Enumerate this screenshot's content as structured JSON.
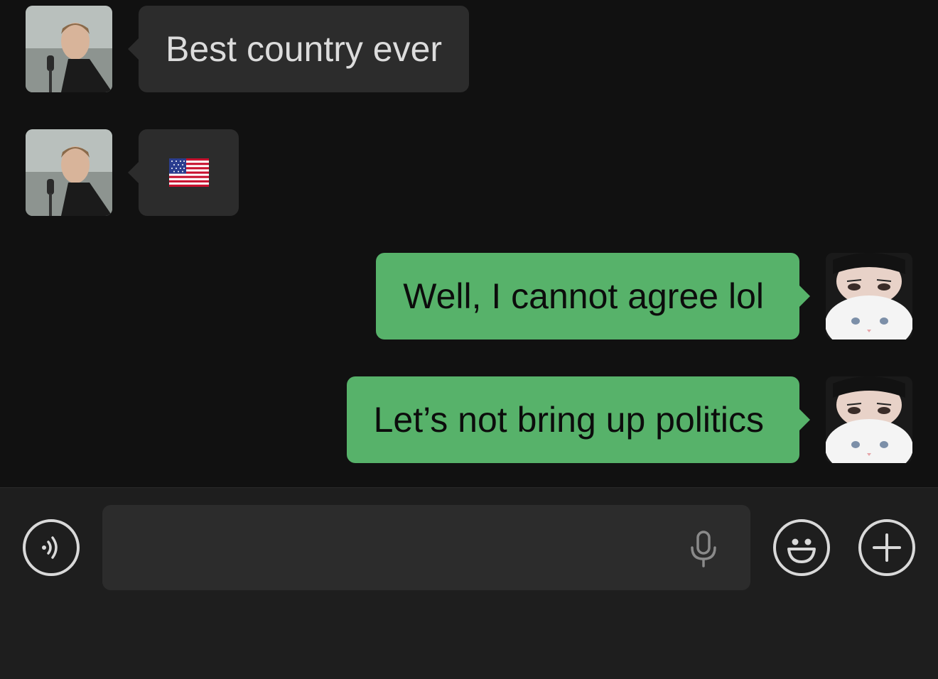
{
  "messages": [
    {
      "direction": "in",
      "sender": "contact",
      "text": "Best country ever"
    },
    {
      "direction": "in",
      "sender": "contact",
      "emoji": "us-flag-emoji"
    },
    {
      "direction": "out",
      "sender": "me",
      "text": "Well, I cannot agree lol"
    },
    {
      "direction": "out",
      "sender": "me",
      "text": "Let’s not bring up politics"
    }
  ],
  "composer": {
    "input_value": "",
    "input_placeholder": "",
    "voice_button_icon": "voice-input-icon",
    "mic_icon": "microphone-icon",
    "emoji_button_icon": "smiley-icon",
    "more_button_icon": "plus-icon"
  },
  "colors": {
    "background": "#111111",
    "incoming_bubble": "#2c2c2c",
    "outgoing_bubble": "#57b26a",
    "composer_bg": "#1e1e1e",
    "input_bg": "#2c2c2c"
  }
}
